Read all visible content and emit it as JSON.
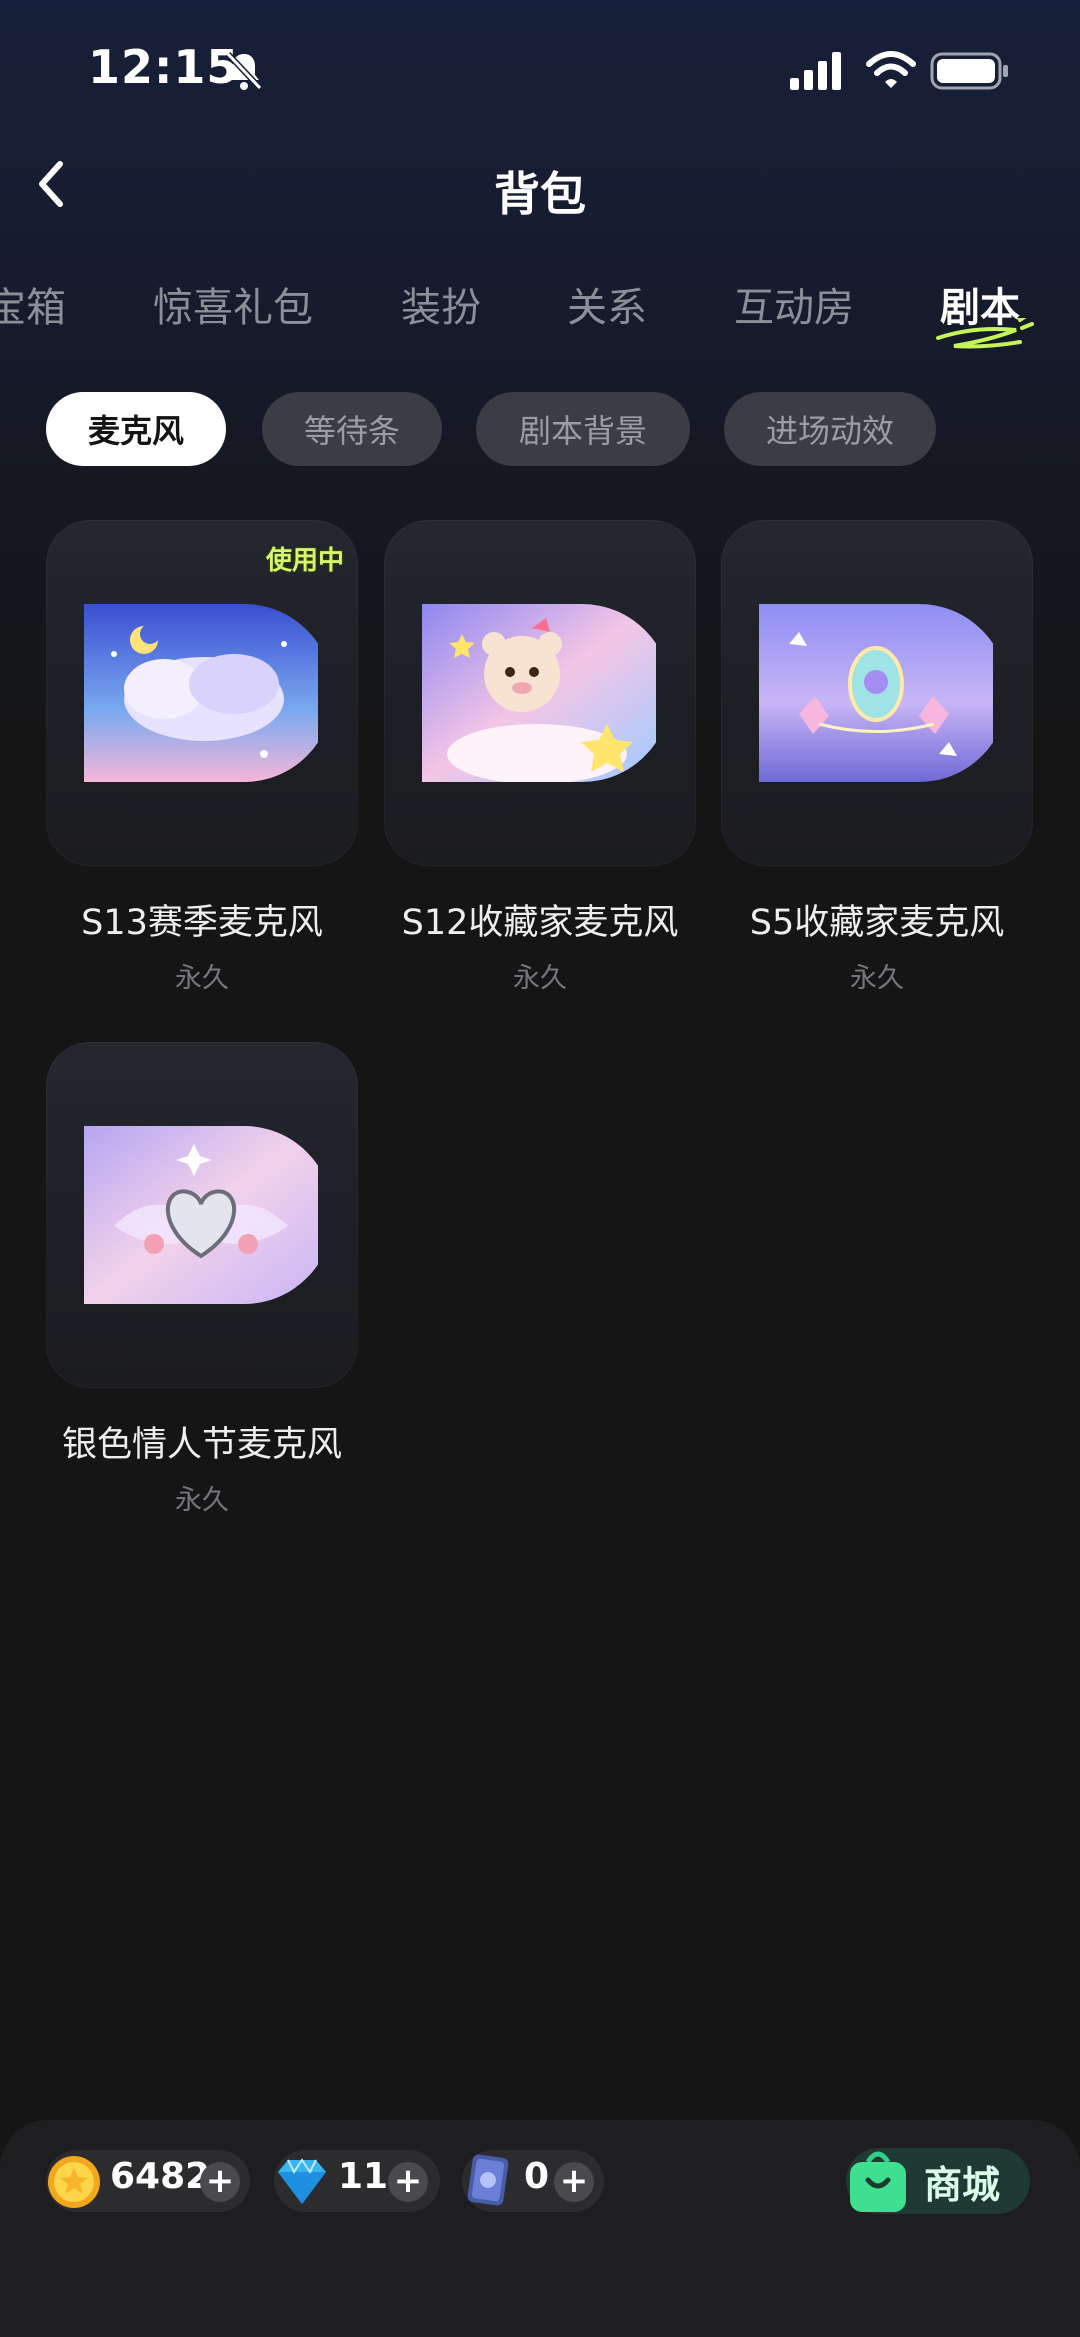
{
  "status_bar": {
    "time": "12:15"
  },
  "header": {
    "title": "背包"
  },
  "tabs": [
    {
      "label": "宝箱"
    },
    {
      "label": "惊喜礼包"
    },
    {
      "label": "装扮"
    },
    {
      "label": "关系"
    },
    {
      "label": "互动房"
    },
    {
      "label": "剧本",
      "active": true
    }
  ],
  "chips": [
    {
      "label": "麦克风",
      "active": true
    },
    {
      "label": "等待条"
    },
    {
      "label": "剧本背景"
    },
    {
      "label": "进场动效"
    }
  ],
  "items": [
    {
      "name": "S13赛季麦克风",
      "duration": "永久",
      "badge": "使用中"
    },
    {
      "name": "S12收藏家麦克风",
      "duration": "永久"
    },
    {
      "name": "S5收藏家麦克风",
      "duration": "永久"
    },
    {
      "name": "银色情人节麦克风",
      "duration": "永久"
    }
  ],
  "wallet": {
    "coins": "6482",
    "diamonds": "11",
    "cards": "0",
    "shop_label": "商城"
  },
  "colors": {
    "accent_green": "#3ee08f",
    "chip_active": "#ffffff",
    "background": "#151515"
  }
}
